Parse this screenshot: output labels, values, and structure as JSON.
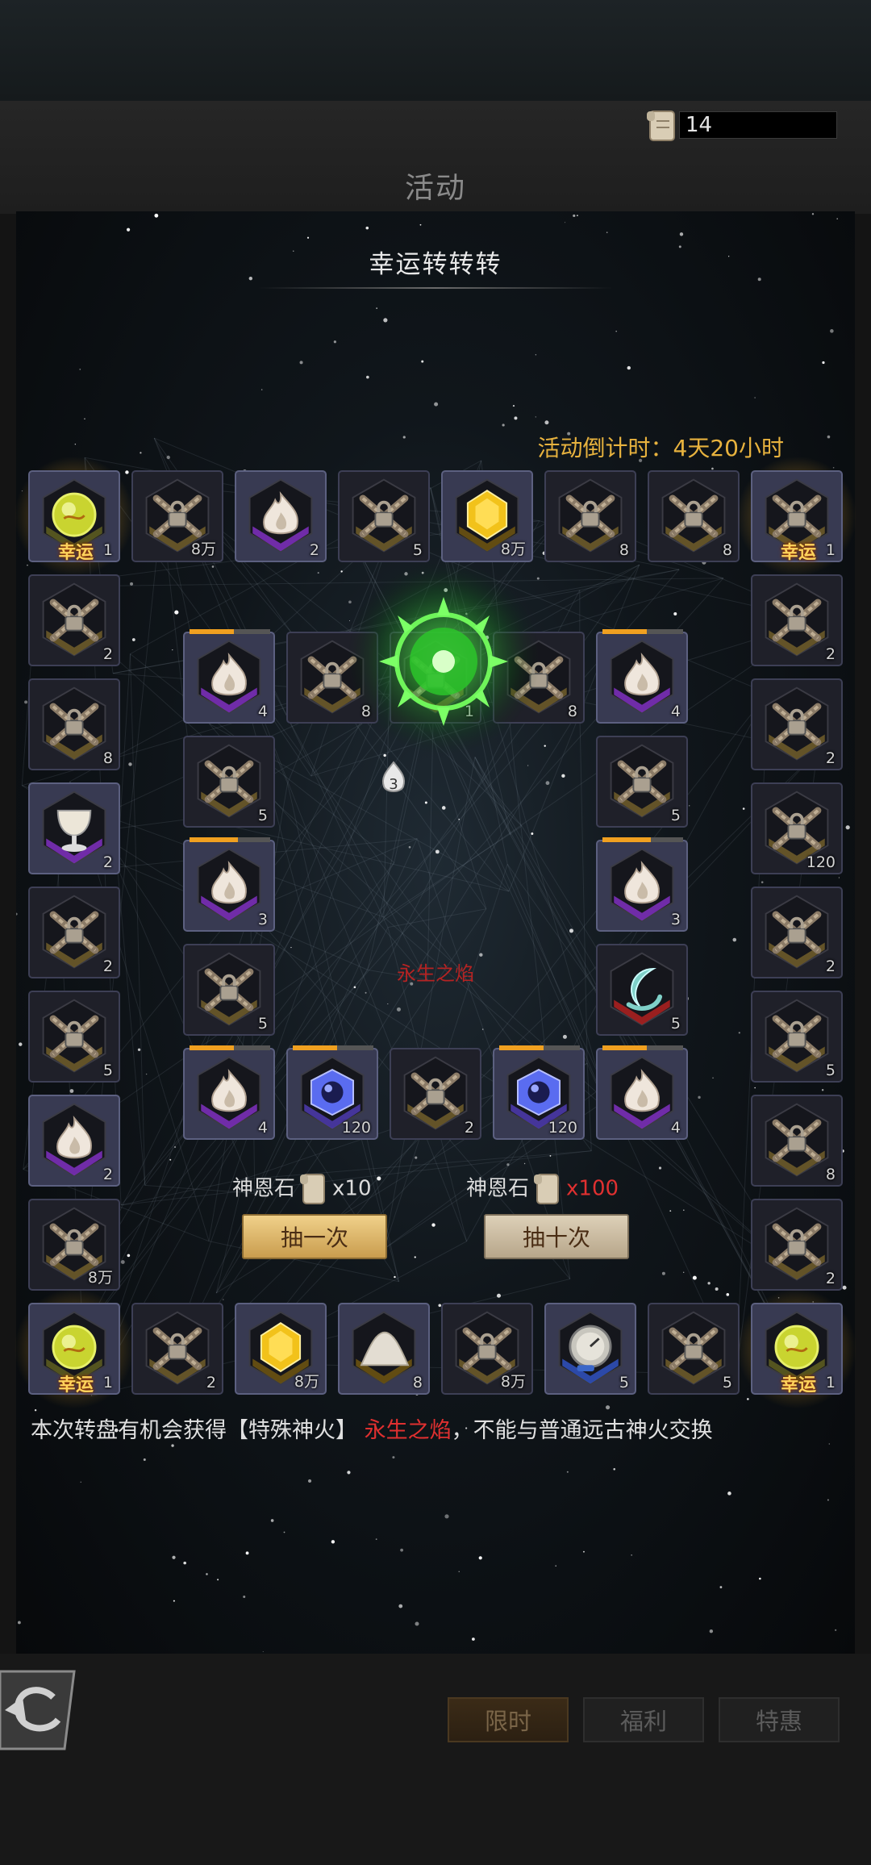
{
  "header": {
    "title": "活动",
    "currency_count": "14"
  },
  "panel": {
    "title": "幸运转转转",
    "countdown_label": "活动倒计时：",
    "countdown_value": "4天20小时",
    "center_label": "永生之焰",
    "remaining_draws": "3"
  },
  "draws": {
    "single": {
      "currency": "神恩石",
      "multiplier": "x10",
      "button": "抽一次"
    },
    "ten": {
      "currency": "神恩石",
      "multiplier": "x100",
      "button": "抽十次"
    }
  },
  "description": {
    "part1": "本次转盘有机会获得【特殊神火】",
    "highlight": "永生之焰",
    "part2": "，不能与普通远古神火交换"
  },
  "tabs": [
    "限时",
    "福利",
    "特惠"
  ],
  "tile_items": {
    "outer_top": [
      {
        "icon": "lucky-orb-icon",
        "qty": "1",
        "label": "幸运"
      },
      {
        "icon": "locked-chest-icon",
        "qty": "8万"
      },
      {
        "icon": "flame-icon",
        "qty": "2"
      },
      {
        "icon": "locked-chest-icon",
        "qty": "5"
      },
      {
        "icon": "gold-crystal-icon",
        "qty": "8万"
      },
      {
        "icon": "locked-chest-icon",
        "qty": "8"
      },
      {
        "icon": "locked-chest-icon",
        "qty": "8"
      },
      {
        "icon": "locked-chest-icon",
        "qty": "1",
        "label": "幸运"
      }
    ],
    "outer_left": [
      {
        "icon": "locked-chest-icon",
        "qty": "2"
      },
      {
        "icon": "locked-chest-icon",
        "qty": "8"
      },
      {
        "icon": "chalice-icon",
        "qty": "2"
      },
      {
        "icon": "locked-chest-icon",
        "qty": "2"
      },
      {
        "icon": "locked-chest-icon",
        "qty": "5"
      },
      {
        "icon": "flame-icon",
        "qty": "2"
      },
      {
        "icon": "locked-chest-icon",
        "qty": "8万"
      }
    ],
    "outer_right": [
      {
        "icon": "locked-chest-icon",
        "qty": "2"
      },
      {
        "icon": "locked-chest-icon",
        "qty": "2"
      },
      {
        "icon": "locked-chest-icon",
        "qty": "120"
      },
      {
        "icon": "locked-chest-icon",
        "qty": "2"
      },
      {
        "icon": "locked-chest-icon",
        "qty": "5"
      },
      {
        "icon": "locked-chest-icon",
        "qty": "8"
      },
      {
        "icon": "locked-chest-icon",
        "qty": "2"
      }
    ],
    "outer_bottom": [
      {
        "icon": "lucky-orb-icon",
        "qty": "1",
        "label": "幸运"
      },
      {
        "icon": "locked-chest-icon",
        "qty": "2"
      },
      {
        "icon": "gold-crystal-icon",
        "qty": "8万"
      },
      {
        "icon": "powder-pile-icon",
        "qty": "8"
      },
      {
        "icon": "locked-chest-icon",
        "qty": "8万"
      },
      {
        "icon": "compass-icon",
        "qty": "5"
      },
      {
        "icon": "locked-chest-icon",
        "qty": "5"
      },
      {
        "icon": "lucky-orb-icon",
        "qty": "1",
        "label": "幸运"
      }
    ],
    "inner_top": [
      {
        "icon": "flame-icon",
        "qty": "4"
      },
      {
        "icon": "locked-chest-icon",
        "qty": "8"
      },
      {
        "icon": "locked-chest-icon",
        "qty": "1"
      },
      {
        "icon": "locked-chest-icon",
        "qty": "8"
      },
      {
        "icon": "flame-icon",
        "qty": "4"
      }
    ],
    "inner_left": [
      {
        "icon": "locked-chest-icon",
        "qty": "5"
      },
      {
        "icon": "flame-icon",
        "qty": "3"
      },
      {
        "icon": "locked-chest-icon",
        "qty": "5"
      }
    ],
    "inner_right": [
      {
        "icon": "locked-chest-icon",
        "qty": "5"
      },
      {
        "icon": "flame-icon",
        "qty": "3"
      },
      {
        "icon": "moon-horn-icon",
        "qty": "5"
      }
    ],
    "inner_bottom": [
      {
        "icon": "flame-icon",
        "qty": "4"
      },
      {
        "icon": "blue-cube-icon",
        "qty": "120"
      },
      {
        "icon": "locked-chest-icon",
        "qty": "2"
      },
      {
        "icon": "blue-cube-icon",
        "qty": "120"
      },
      {
        "icon": "flame-icon",
        "qty": "4"
      }
    ]
  },
  "colors": {
    "accent_gold": "#e7b23e",
    "countdown": "#e7b23e",
    "highlight_red": "#e03030",
    "lucky_text": "#ffd35c"
  }
}
